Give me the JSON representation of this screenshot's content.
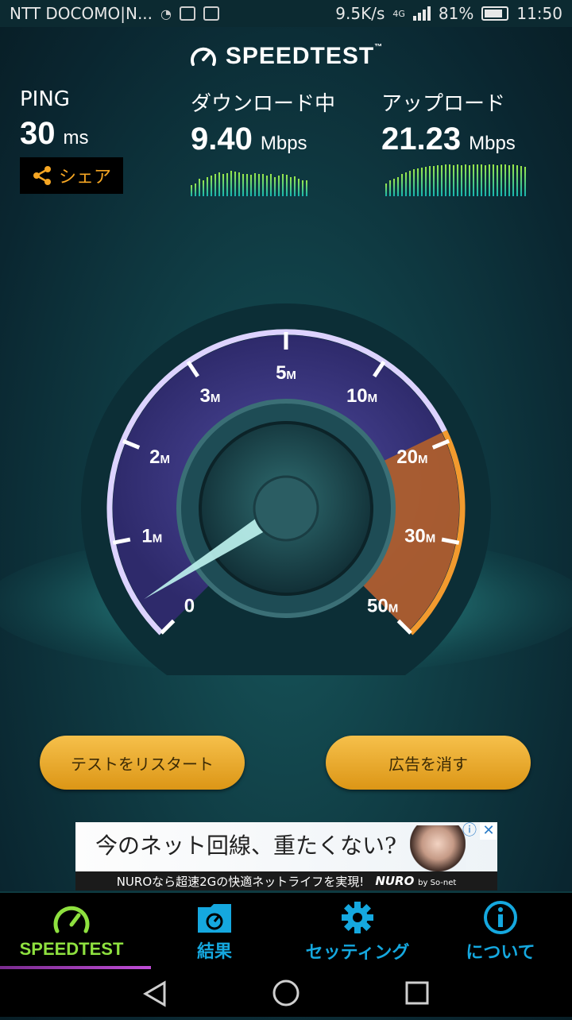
{
  "status_bar": {
    "carrier": "NTT DOCOMO|N...",
    "net_speed": "9.5K/s",
    "network_type": "4G",
    "battery": "81%",
    "time": "11:50"
  },
  "app": {
    "logo_text": "SPEEDTEST",
    "logo_tm": "™"
  },
  "metrics": {
    "ping": {
      "label": "PING",
      "value": "30",
      "unit": "ms"
    },
    "download": {
      "label": "ダウンロード中",
      "value": "9.40",
      "unit": "Mbps",
      "spark": [
        0.35,
        0.4,
        0.55,
        0.5,
        0.6,
        0.65,
        0.7,
        0.75,
        0.7,
        0.72,
        0.8,
        0.78,
        0.75,
        0.7,
        0.7,
        0.68,
        0.72,
        0.7,
        0.7,
        0.65,
        0.7,
        0.6,
        0.65,
        0.7,
        0.68,
        0.6,
        0.62,
        0.55,
        0.5,
        0.5
      ]
    },
    "upload": {
      "label": "アップロード",
      "value": "21.23",
      "unit": "Mbps",
      "spark": [
        0.4,
        0.5,
        0.55,
        0.6,
        0.7,
        0.75,
        0.8,
        0.85,
        0.88,
        0.9,
        0.92,
        0.95,
        0.95,
        0.97,
        0.98,
        1,
        1,
        0.98,
        1,
        0.98,
        1,
        0.97,
        1,
        1,
        0.99,
        0.98,
        1,
        1,
        0.98,
        1,
        1,
        0.97,
        1,
        0.98,
        0.95,
        0.92
      ]
    }
  },
  "share_button": {
    "label": "シェア",
    "icon": "share-icon"
  },
  "gauge": {
    "ticks": [
      {
        "num": "0",
        "unit": ""
      },
      {
        "num": "1",
        "unit": "M"
      },
      {
        "num": "2",
        "unit": "M"
      },
      {
        "num": "3",
        "unit": "M"
      },
      {
        "num": "5",
        "unit": "M"
      },
      {
        "num": "10",
        "unit": "M"
      },
      {
        "num": "20",
        "unit": "M"
      },
      {
        "num": "30",
        "unit": "M"
      },
      {
        "num": "50",
        "unit": "M"
      }
    ],
    "needle_value_mbps": 0.3,
    "colors": {
      "arc": "#b7a4ff",
      "accent": "#f29a2e"
    }
  },
  "buttons": {
    "restart": "テストをリスタート",
    "remove_ads": "広告を消す"
  },
  "ad": {
    "headline": "今のネット回線、重たくない?",
    "subline": "NUROなら超速2Gの快適ネットライフを実現!",
    "brand": "NURO",
    "brand_by": "by So-net",
    "info_icon": "info-icon",
    "close_icon": "close-icon"
  },
  "bottom_nav": [
    {
      "label": "SPEEDTEST",
      "icon": "speedometer-icon",
      "active": true
    },
    {
      "label": "結果",
      "icon": "results-folder-icon",
      "active": false
    },
    {
      "label": "セッティング",
      "icon": "gear-icon",
      "active": false
    },
    {
      "label": "について",
      "icon": "info-icon",
      "active": false
    }
  ],
  "colors": {
    "active_nav": "#8ee03f",
    "inactive_nav": "#15a8df",
    "button": "#f0b135"
  }
}
